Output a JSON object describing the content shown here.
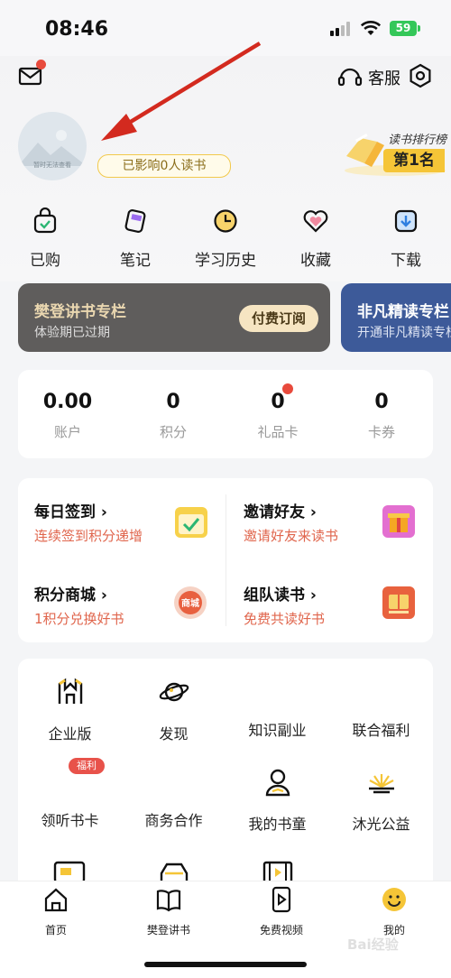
{
  "status_bar": {
    "time": "08:46",
    "battery": "59"
  },
  "header": {
    "service_label": "客服",
    "avatar_text": "暂时无法查看",
    "influence_text": "已影响0人读书",
    "rank_title": "读书排行榜",
    "rank_badge": "第1名"
  },
  "quick_actions": [
    {
      "label": "已购",
      "icon": "shopping-bag-icon"
    },
    {
      "label": "笔记",
      "icon": "note-icon"
    },
    {
      "label": "学习历史",
      "icon": "clock-icon"
    },
    {
      "label": "收藏",
      "icon": "heart-icon"
    },
    {
      "label": "下载",
      "icon": "download-icon"
    }
  ],
  "banners": [
    {
      "title": "樊登讲书专栏",
      "subtitle": "体验期已过期",
      "button": "付费订阅"
    },
    {
      "title": "非凡精读专栏",
      "subtitle": "开通非凡精读专栏"
    }
  ],
  "stats": [
    {
      "value": "0.00",
      "label": "账户"
    },
    {
      "value": "0",
      "label": "积分"
    },
    {
      "value": "0",
      "label": "礼品卡"
    },
    {
      "value": "0",
      "label": "卡券"
    }
  ],
  "tasks": [
    {
      "title": "每日签到 ›",
      "subtitle": "连续签到积分递增",
      "icon": "calendar-check-icon"
    },
    {
      "title": "邀请好友 ›",
      "subtitle": "邀请好友来读书",
      "icon": "gift-icon"
    },
    {
      "title": "积分商城 ›",
      "subtitle": "1积分兑换好书",
      "icon": "mall-icon",
      "icon_text": "商城"
    },
    {
      "title": "组队读书 ›",
      "subtitle": "免费共读好书",
      "icon": "book-team-icon"
    }
  ],
  "services": [
    {
      "label": "企业版",
      "icon": "enterprise-icon"
    },
    {
      "label": "发现",
      "icon": "planet-icon"
    },
    {
      "label": "知识副业",
      "icon": ""
    },
    {
      "label": "联合福利",
      "icon": ""
    },
    {
      "label": "领听书卡",
      "icon": "",
      "badge": "福利"
    },
    {
      "label": "商务合作",
      "icon": ""
    },
    {
      "label": "我的书童",
      "icon": "person-book-icon"
    },
    {
      "label": "沐光公益",
      "icon": "sunrise-icon"
    }
  ],
  "tabs": [
    {
      "label": "首页",
      "icon": "home-icon"
    },
    {
      "label": "樊登讲书",
      "icon": "book-icon"
    },
    {
      "label": "免费视频",
      "icon": "video-icon"
    },
    {
      "label": "我的",
      "icon": "smiley-icon"
    }
  ],
  "watermark": "Bai经验",
  "colors": {
    "accent_red": "#e84a3c",
    "gold": "#f5c537",
    "banner_dark": "#5f5d5c",
    "banner_blue": "#3d5a99"
  }
}
